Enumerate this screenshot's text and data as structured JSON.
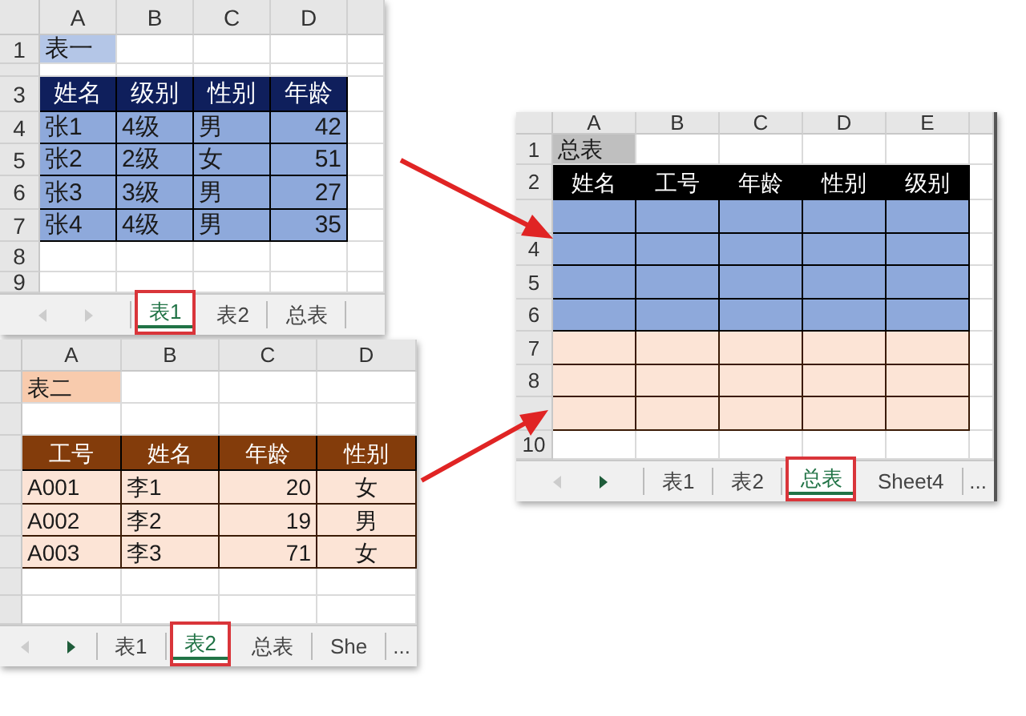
{
  "sheets": [
    {
      "columns": [
        "A",
        "B",
        "C",
        "D"
      ],
      "rows": [
        {
          "number": "1",
          "cells": [
            {
              "text": "表一",
              "color": "#b4c6e7"
            }
          ]
        },
        {},
        {
          "number": "3",
          "color": "#0f1f5c",
          "cells": [
            {
              "text": "姓名",
              "kind": "center"
            },
            {
              "text": "级别",
              "kind": "center"
            },
            {
              "text": "性别",
              "kind": "center"
            },
            {
              "text": "年龄",
              "kind": "center"
            }
          ]
        },
        {
          "number": "4",
          "color": "#8ea9db",
          "cells": [
            {
              "text": "张1"
            },
            {
              "text": "4级"
            },
            {
              "text": "男"
            },
            {
              "text": "42",
              "kind": "number"
            }
          ]
        },
        {
          "number": "5",
          "color": "#8ea9db",
          "cells": [
            {
              "text": "张2"
            },
            {
              "text": "2级"
            },
            {
              "text": "女"
            },
            {
              "text": "51",
              "kind": "number"
            }
          ]
        },
        {
          "number": "6",
          "color": "#8ea9db",
          "cells": [
            {
              "text": "张3"
            },
            {
              "text": "3级"
            },
            {
              "text": "男"
            },
            {
              "text": "27",
              "kind": "number"
            }
          ]
        },
        {
          "number": "7",
          "color": "#8ea9db",
          "cells": [
            {
              "text": "张4"
            },
            {
              "text": "4级"
            },
            {
              "text": "男"
            },
            {
              "text": "35",
              "kind": "number"
            }
          ]
        },
        {
          "number": "8"
        },
        {
          "number": "9"
        }
      ],
      "tabs": [
        {
          "label": "表1",
          "selected": true
        },
        {
          "label": "表2",
          "selected": false
        },
        {
          "label": "总表",
          "selected": false
        }
      ]
    },
    {
      "columns": [
        "A",
        "B",
        "C",
        "D"
      ],
      "rows": [
        {
          "cells": [
            {
              "text": "表二",
              "color": "#f8cbad"
            }
          ]
        },
        {},
        {
          "color": "#833c0b",
          "cells": [
            {
              "text": "工号",
              "kind": "center"
            },
            {
              "text": "姓名",
              "kind": "center"
            },
            {
              "text": "年龄",
              "kind": "center"
            },
            {
              "text": "性别",
              "kind": "center"
            }
          ]
        },
        {
          "color": "#fce4d6",
          "cells": [
            {
              "text": "A001"
            },
            {
              "text": "李1"
            },
            {
              "text": "20",
              "kind": "number"
            },
            {
              "text": "女",
              "kind": "center"
            }
          ]
        },
        {
          "color": "#fce4d6",
          "cells": [
            {
              "text": "A002"
            },
            {
              "text": "李2"
            },
            {
              "text": "19",
              "kind": "number"
            },
            {
              "text": "男",
              "kind": "center"
            }
          ]
        },
        {
          "color": "#fce4d6",
          "cells": [
            {
              "text": "A003"
            },
            {
              "text": "李3"
            },
            {
              "text": "71",
              "kind": "number"
            },
            {
              "text": "女",
              "kind": "center"
            }
          ]
        },
        {},
        {}
      ],
      "tabs": [
        {
          "label": "表1",
          "selected": false
        },
        {
          "label": "表2",
          "selected": true
        },
        {
          "label": "总表",
          "selected": false
        },
        {
          "label": "She",
          "selected": false
        }
      ],
      "more": "..."
    },
    {
      "columns": [
        "A",
        "B",
        "C",
        "D",
        "E"
      ],
      "rows": [
        {
          "number": "1",
          "cells": [
            {
              "text": "总表",
              "color": "#bfbfbf"
            }
          ]
        },
        {
          "number": "2",
          "color": "#000000",
          "cells": [
            {
              "text": "姓名",
              "kind": "center"
            },
            {
              "text": "工号",
              "kind": "center"
            },
            {
              "text": "年龄",
              "kind": "center"
            },
            {
              "text": "性别",
              "kind": "center"
            },
            {
              "text": "级别",
              "kind": "center"
            }
          ]
        },
        {
          "color": "#8ea9db"
        },
        {
          "number": "4",
          "color": "#8ea9db"
        },
        {
          "number": "5",
          "color": "#8ea9db"
        },
        {
          "number": "6",
          "color": "#8ea9db"
        },
        {
          "number": "7",
          "color": "#fce4d6"
        },
        {
          "number": "8",
          "color": "#fce4d6"
        },
        {
          "color": "#fce4d6"
        },
        {
          "number": "10"
        }
      ],
      "tabs": [
        {
          "label": "表1",
          "selected": false
        },
        {
          "label": "表2",
          "selected": false
        },
        {
          "label": "总表",
          "selected": true
        },
        {
          "label": "Sheet4",
          "selected": false
        }
      ],
      "more": "..."
    }
  ]
}
